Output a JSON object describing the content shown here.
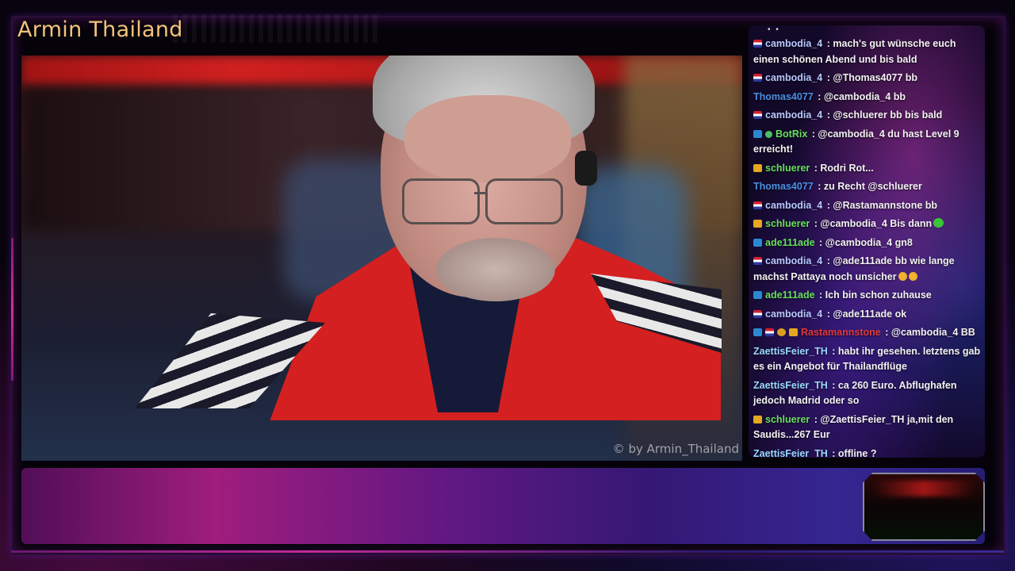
{
  "channel": {
    "title": "Armin Thailand",
    "watermark": "© by Armin_Thailand"
  },
  "chat": {
    "messages": [
      {
        "badges": [
          "flag"
        ],
        "user": "cambodia_4",
        "user_color": "#b8c8ff",
        "text": "mach's gut wünsche euch einen schönen Abend und bis bald"
      },
      {
        "badges": [
          "flag"
        ],
        "user": "cambodia_4",
        "user_color": "#b8c8ff",
        "text": "@Thomas4077 bb"
      },
      {
        "badges": [],
        "user": "Thomas4077",
        "user_color": "#4a90e2",
        "text": "@cambodia_4 bb"
      },
      {
        "badges": [
          "flag"
        ],
        "user": "cambodia_4",
        "user_color": "#b8c8ff",
        "text": "@schluerer bb bis bald"
      },
      {
        "badges": [
          "prime",
          "verified"
        ],
        "user": "BotRix",
        "user_color": "#66e05a",
        "text": "@cambodia_4 du hast Level 9 erreicht!"
      },
      {
        "badges": [
          "crown"
        ],
        "user": "schluerer",
        "user_color": "#66e05a",
        "text": "Rodri Rot..."
      },
      {
        "badges": [],
        "user": "Thomas4077",
        "user_color": "#4a90e2",
        "text": "zu Recht @schluerer"
      },
      {
        "badges": [
          "flag"
        ],
        "user": "cambodia_4",
        "user_color": "#b8c8ff",
        "text": "@Rastamannstone bb"
      },
      {
        "badges": [
          "crown"
        ],
        "user": "schluerer",
        "user_color": "#66e05a",
        "text": "@cambodia_4 Bis dann",
        "emoji": [
          "green"
        ]
      },
      {
        "badges": [
          "prime"
        ],
        "user": "ade111ade",
        "user_color": "#66e05a",
        "text": "@cambodia_4 gn8"
      },
      {
        "badges": [
          "flag"
        ],
        "user": "cambodia_4",
        "user_color": "#b8c8ff",
        "text": "@ade111ade bb wie lange machst Pattaya noch unsicher",
        "emoji": [
          "laugh",
          "laugh"
        ]
      },
      {
        "badges": [
          "prime"
        ],
        "user": "ade111ade",
        "user_color": "#66e05a",
        "text": "Ich bin schon zuhause"
      },
      {
        "badges": [
          "flag"
        ],
        "user": "cambodia_4",
        "user_color": "#b8c8ff",
        "text": "@ade111ade ok"
      },
      {
        "badges": [
          "prime",
          "flag",
          "gold",
          "crown"
        ],
        "user": "Rastamannstone",
        "user_color": "#e0383a",
        "text": "@cambodia_4 BB"
      },
      {
        "badges": [],
        "user": "ZaettisFeier_TH",
        "user_color": "#9ad8ff",
        "text": "habt ihr gesehen. letztens gab es ein Angebot für Thailandflüge"
      },
      {
        "badges": [],
        "user": "ZaettisFeier_TH",
        "user_color": "#9ad8ff",
        "text": "ca 260 Euro. Abflughafen jedoch Madrid oder so"
      },
      {
        "badges": [
          "crown"
        ],
        "user": "schluerer",
        "user_color": "#66e05a",
        "text": "@ZaettisFeier_TH ja,mit den Saudis...267 Eur"
      },
      {
        "badges": [],
        "user": "ZaettisFeier_TH",
        "user_color": "#9ad8ff",
        "text": "offline ?"
      }
    ]
  }
}
